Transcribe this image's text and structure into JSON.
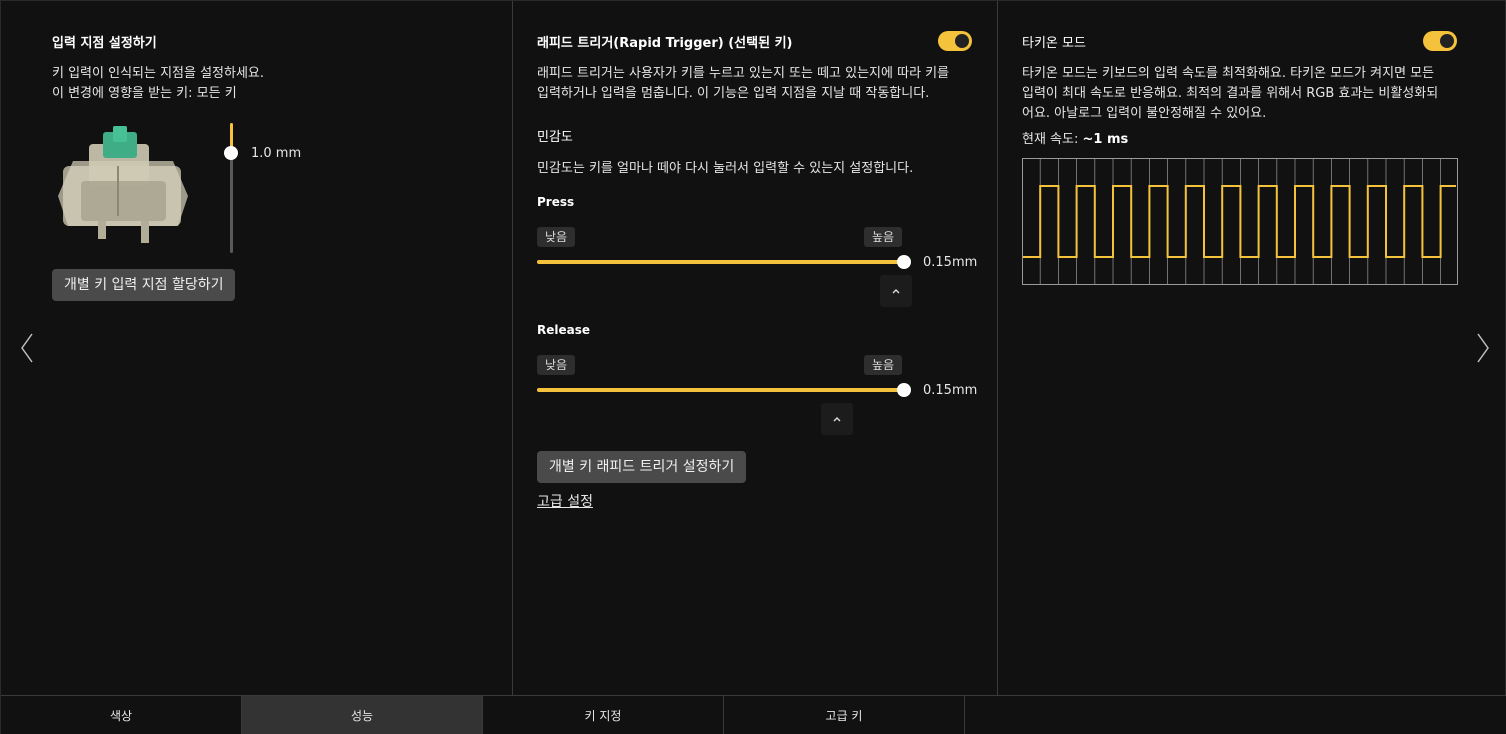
{
  "actuation": {
    "title": "입력 지점 설정하기",
    "desc_line1": "키 입력이 인식되는 지점을 설정하세요.",
    "desc_line2": "이 변경에 영향을 받는 키: 모든 키",
    "slider_value": "1.0 mm",
    "slider_level": 0.2,
    "assign_button": "개별 키 입력 지점 할당하기"
  },
  "rapid_trigger": {
    "title": "래피드 트리거(Rapid Trigger) (선택된 키)",
    "enabled": true,
    "desc_line1": "래피드 트리거는 사용자가 키를 누르고 있는지 또는 떼고 있는지에 따라 키를",
    "desc_line2": "입력하거나 입력을 멈춥니다. 이 기능은 입력 지점을 지날 때 작동합니다.",
    "sensitivity_title": "민감도",
    "sensitivity_desc": "민감도는 키를 얼마나 떼야 다시 눌러서 입력할 수 있는지 설정합니다.",
    "press": {
      "label": "Press",
      "low": "낮음",
      "high": "높음",
      "value": "0.15mm",
      "level": 1.0
    },
    "release": {
      "label": "Release",
      "low": "낮음",
      "high": "높음",
      "value": "0.15mm",
      "level": 1.0
    },
    "individual_button": "개별 키 래피드 트리거 설정하기",
    "advanced_link": "고급 설정"
  },
  "tachyon": {
    "title": "타키온 모드",
    "enabled": true,
    "desc_line1": "타키온 모드는 키보드의 입력 속도를 최적화해요. 타키온 모드가 켜지면 모든",
    "desc_line2": "입력이 최대 속도로 반응해요. 최적의 결과를 위해서 RGB 효과는 비활성화되",
    "desc_line3": "어요. 아날로그 입력이 불안정해질 수 있어요.",
    "speed_label": "현재 속도:",
    "speed_value": "~1 ms"
  },
  "tabs": [
    "색상",
    "성능",
    "키 지정",
    "고급 키"
  ],
  "active_tab": 1,
  "colors": {
    "accent": "#f5c33b",
    "background": "#111111",
    "panel_border": "#3a3a3a"
  },
  "icons": {
    "prev": "chevron-left-icon",
    "next": "chevron-right-icon",
    "collapse": "chevron-up-icon"
  }
}
